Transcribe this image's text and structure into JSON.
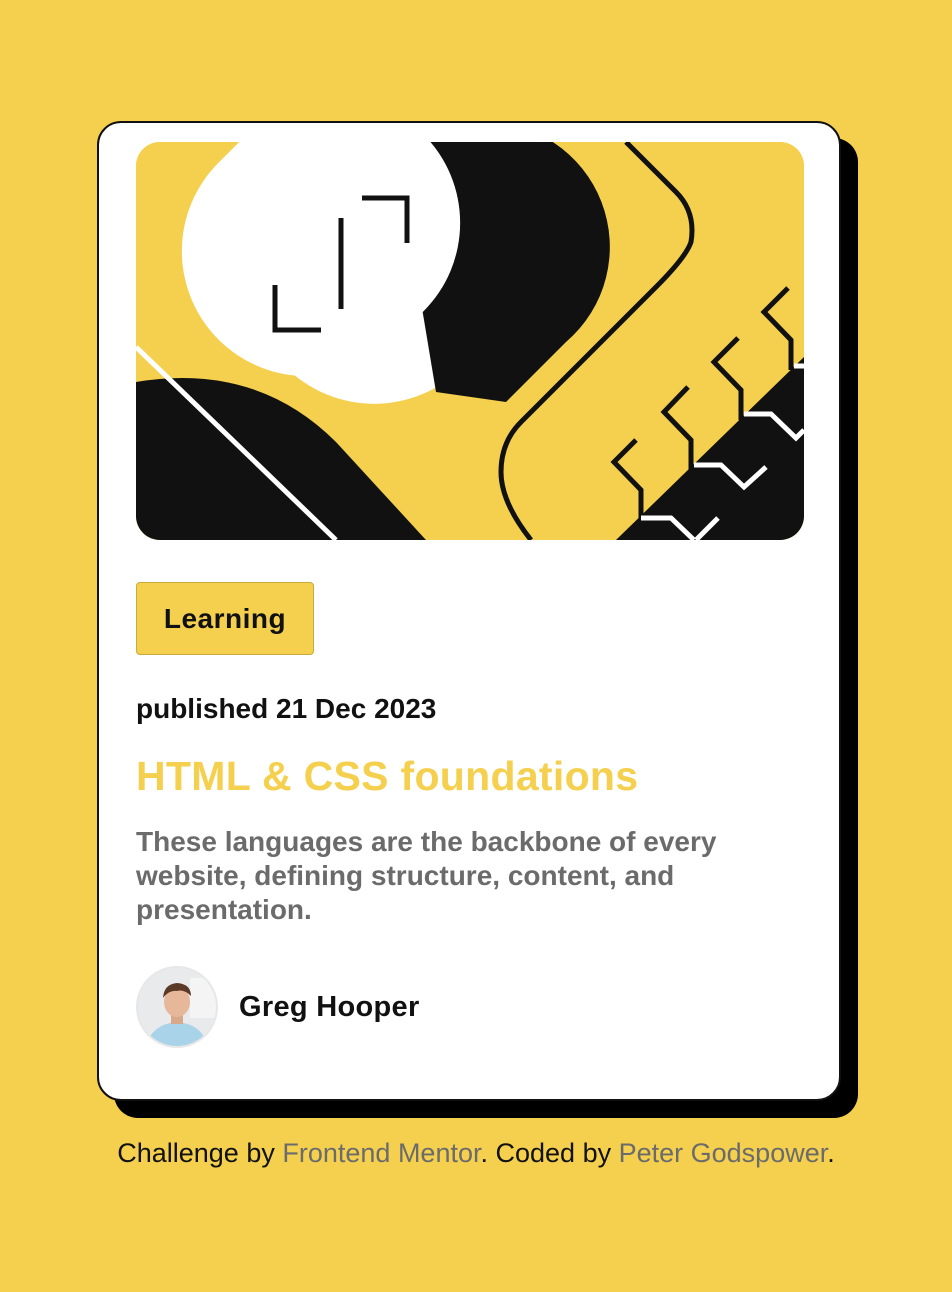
{
  "card": {
    "category": "Learning",
    "published": "published 21 Dec 2023",
    "title": "HTML & CSS foundations",
    "description": "These languages are the backbone of every website, defining structure, content, and presentation.",
    "author": "Greg Hooper"
  },
  "footer": {
    "prefix": "Challenge by",
    "link1": "Frontend Mentor",
    "middle": ". Coded by",
    "link2": "Peter Godspower",
    "suffix": "."
  },
  "colors": {
    "background": "#f4d04e",
    "card": "#ffffff",
    "ink": "#111111",
    "muted": "#6b6b6b"
  },
  "icons": {
    "avatar": "person-avatar",
    "hero": "abstract-illustration"
  }
}
